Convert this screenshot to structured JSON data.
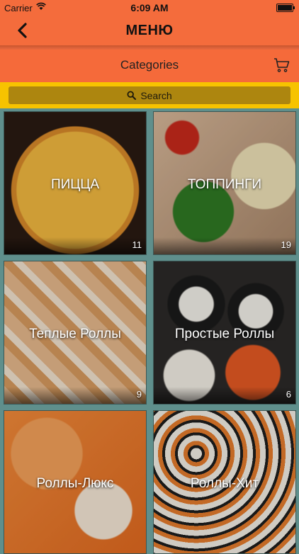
{
  "status_bar": {
    "carrier": "Carrier",
    "time": "6:09 AM"
  },
  "nav": {
    "title": "МЕНЮ",
    "back_icon": "chevron-left-icon"
  },
  "category_header": {
    "label": "Categories",
    "cart_icon": "cart-icon"
  },
  "search": {
    "placeholder": "Search",
    "icon": "search-icon"
  },
  "categories": [
    {
      "name": "ПИЦЦА",
      "count": "11"
    },
    {
      "name": "ТОППИНГИ",
      "count": "19"
    },
    {
      "name": "Теплые Роллы",
      "count": "9"
    },
    {
      "name": "Простые Роллы",
      "count": "6"
    },
    {
      "name": "Роллы-Люкс",
      "count": ""
    },
    {
      "name": "Роллы-Хит",
      "count": ""
    }
  ],
  "colors": {
    "accent": "#f46c3c",
    "search_bar": "#f7c300",
    "background": "#5f8f8c"
  }
}
